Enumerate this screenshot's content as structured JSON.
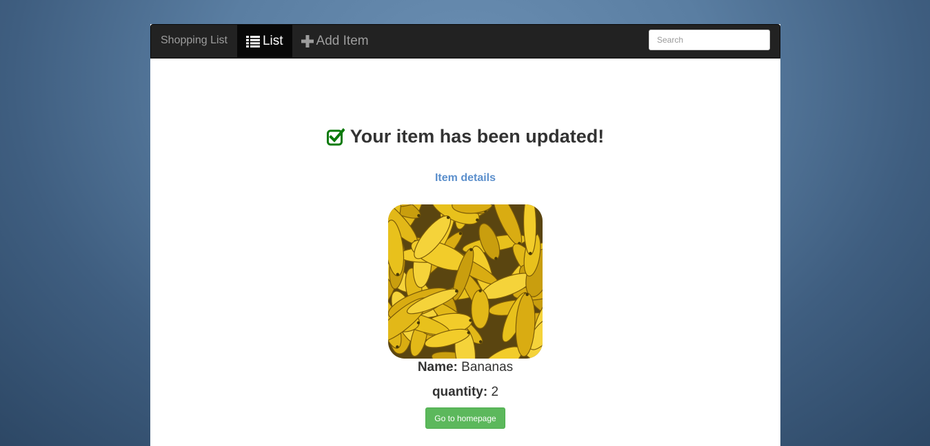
{
  "navbar": {
    "brand": "Shopping List",
    "items": [
      {
        "label": "List",
        "icon": "list-icon",
        "active": true
      },
      {
        "label": "Add Item",
        "icon": "plus-icon",
        "active": false
      }
    ],
    "search": {
      "placeholder": "Search",
      "value": ""
    }
  },
  "main": {
    "heading": "Your item has been updated!",
    "heading_icon": "check-square-icon",
    "details_link": "Item details",
    "item": {
      "image": "bananas-photo",
      "name_label": "Name:",
      "name_value": "Bananas",
      "quantity_label": "quantity:",
      "quantity_value": "2"
    },
    "home_button": "Go to homepage"
  },
  "colors": {
    "navbar_bg": "#222222",
    "nav_active_bg": "#080808",
    "check_icon": "#0a7a0a",
    "link": "#5b8fcc",
    "button_success": "#5cb85c",
    "text": "#333333"
  }
}
